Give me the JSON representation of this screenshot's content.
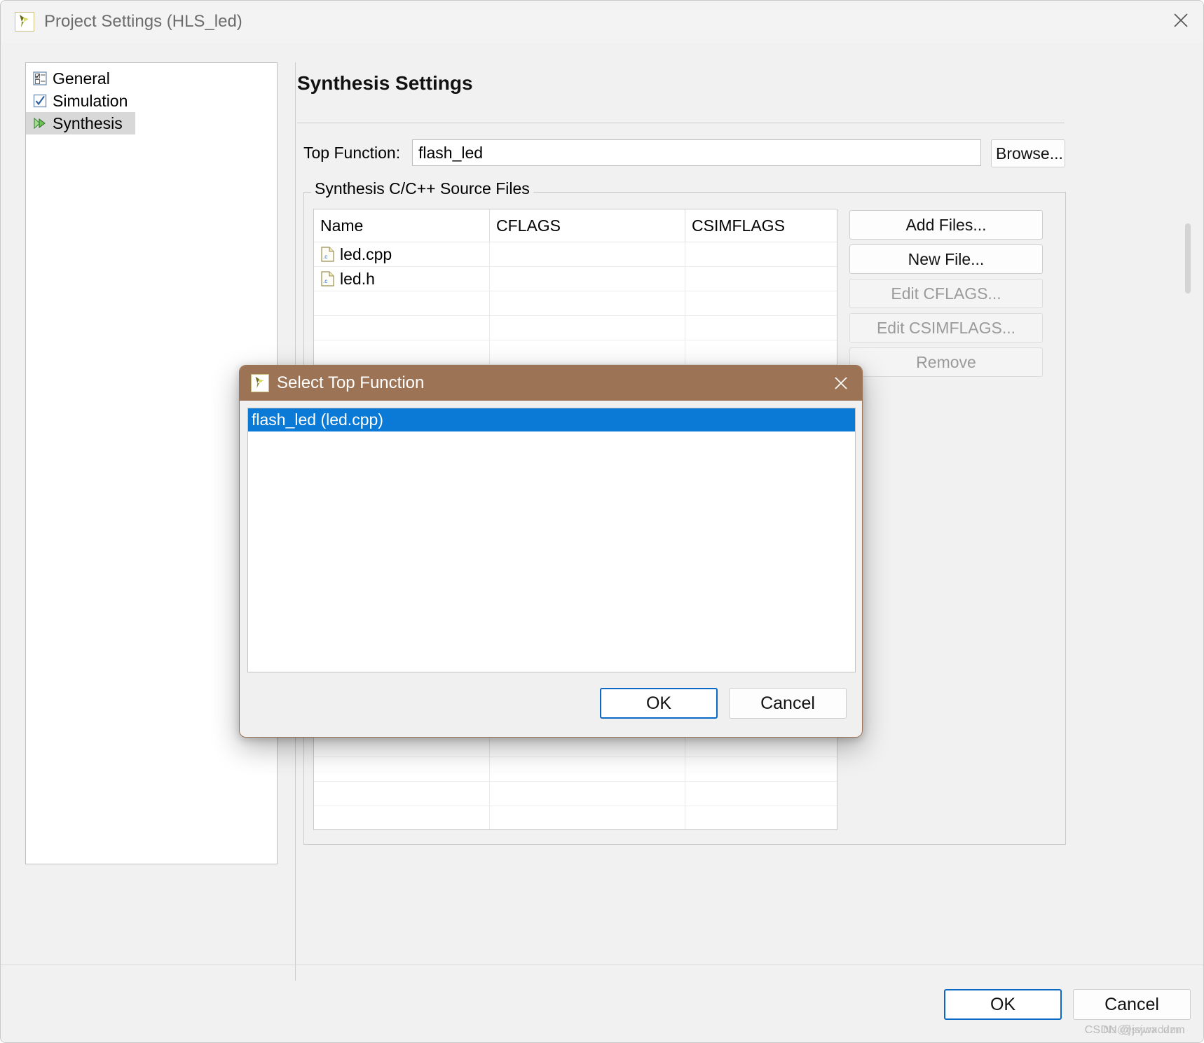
{
  "window": {
    "title": "Project Settings (HLS_led)",
    "app_icon": "vivado-logo-icon",
    "close_icon": "close-icon"
  },
  "sidebar": {
    "items": [
      {
        "label": "General",
        "icon": "checklist-icon",
        "selected": false
      },
      {
        "label": "Simulation",
        "icon": "checkbox-check-icon",
        "selected": false
      },
      {
        "label": "Synthesis",
        "icon": "green-play-icon",
        "selected": true
      }
    ]
  },
  "main": {
    "page_title": "Synthesis Settings",
    "top_function": {
      "label": "Top Function:",
      "value": "flash_led",
      "placeholder": "",
      "browse_label": "Browse..."
    },
    "group": {
      "legend": "Synthesis C/C++ Source Files",
      "table": {
        "columns": [
          "Name",
          "CFLAGS",
          "CSIMFLAGS"
        ],
        "rows": [
          {
            "name": "led.cpp",
            "icon": "c-file-icon",
            "cflags": "",
            "csimflags": ""
          },
          {
            "name": "led.h",
            "icon": "c-file-icon",
            "cflags": "",
            "csimflags": ""
          },
          {
            "name": "",
            "icon": "",
            "cflags": "",
            "csimflags": ""
          },
          {
            "name": "",
            "icon": "",
            "cflags": "",
            "csimflags": ""
          },
          {
            "name": "",
            "icon": "",
            "cflags": "",
            "csimflags": ""
          },
          {
            "name": "",
            "icon": "",
            "cflags": "",
            "csimflags": ""
          },
          {
            "name": "",
            "icon": "",
            "cflags": "",
            "csimflags": ""
          },
          {
            "name": "",
            "icon": "",
            "cflags": "",
            "csimflags": ""
          },
          {
            "name": "",
            "icon": "",
            "cflags": "",
            "csimflags": ""
          },
          {
            "name": "",
            "icon": "",
            "cflags": "",
            "csimflags": ""
          },
          {
            "name": "",
            "icon": "",
            "cflags": "",
            "csimflags": ""
          },
          {
            "name": "",
            "icon": "",
            "cflags": "",
            "csimflags": ""
          },
          {
            "name": "",
            "icon": "",
            "cflags": "",
            "csimflags": ""
          },
          {
            "name": "",
            "icon": "",
            "cflags": "",
            "csimflags": ""
          },
          {
            "name": "",
            "icon": "",
            "cflags": "",
            "csimflags": ""
          },
          {
            "name": "",
            "icon": "",
            "cflags": "",
            "csimflags": ""
          },
          {
            "name": "",
            "icon": "",
            "cflags": "",
            "csimflags": ""
          },
          {
            "name": "",
            "icon": "",
            "cflags": "",
            "csimflags": ""
          },
          {
            "name": "",
            "icon": "",
            "cflags": "",
            "csimflags": ""
          },
          {
            "name": "",
            "icon": "",
            "cflags": "",
            "csimflags": ""
          },
          {
            "name": "",
            "icon": "",
            "cflags": "",
            "csimflags": ""
          },
          {
            "name": "",
            "icon": "",
            "cflags": "",
            "csimflags": ""
          },
          {
            "name": "",
            "icon": "",
            "cflags": "",
            "csimflags": ""
          },
          {
            "name": "",
            "icon": "",
            "cflags": "",
            "csimflags": ""
          },
          {
            "name": "",
            "icon": "",
            "cflags": "",
            "csimflags": ""
          }
        ]
      },
      "buttons": [
        {
          "label": "Add Files...",
          "enabled": true
        },
        {
          "label": "New File...",
          "enabled": true
        },
        {
          "label": "Edit CFLAGS...",
          "enabled": false
        },
        {
          "label": "Edit CSIMFLAGS...",
          "enabled": false
        },
        {
          "label": "Remove",
          "enabled": false
        }
      ]
    },
    "footer": {
      "ok_label": "OK",
      "cancel_label": "Cancel",
      "watermark": "CSDN @jsjwxcdzm",
      "watermark_overlay": "Ns@jswcadzm"
    }
  },
  "modal": {
    "title": "Select Top Function",
    "icon": "vivado-logo-icon",
    "close_icon": "close-icon",
    "list": [
      {
        "label": "flash_led (led.cpp)",
        "selected": true
      }
    ],
    "ok_label": "OK",
    "cancel_label": "Cancel"
  },
  "colors": {
    "modal_title_bar": "#9c7355",
    "selection_blue": "#0a7ad6",
    "focus_blue": "#0a69c4",
    "window_bg": "#f1f1f1",
    "tree_selection": "#d8d8d8"
  }
}
